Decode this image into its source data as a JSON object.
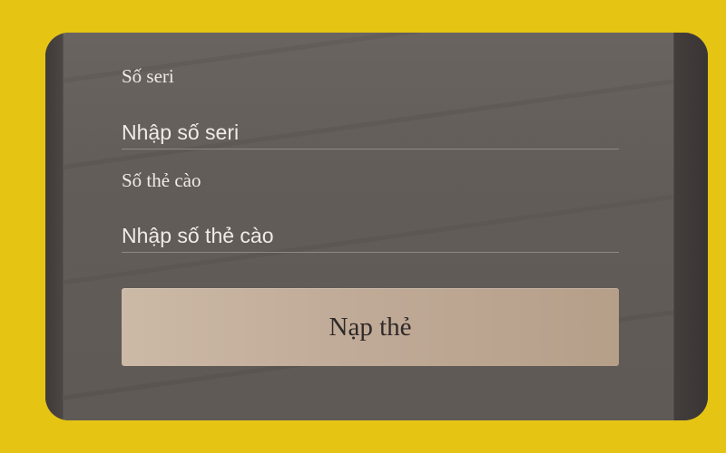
{
  "form": {
    "serial": {
      "label": "Số seri",
      "placeholder": "Nhập số seri",
      "value": ""
    },
    "card_number": {
      "label": "Số thẻ cào",
      "placeholder": "Nhập số thẻ cào",
      "value": ""
    },
    "submit_label": "Nạp thẻ"
  }
}
